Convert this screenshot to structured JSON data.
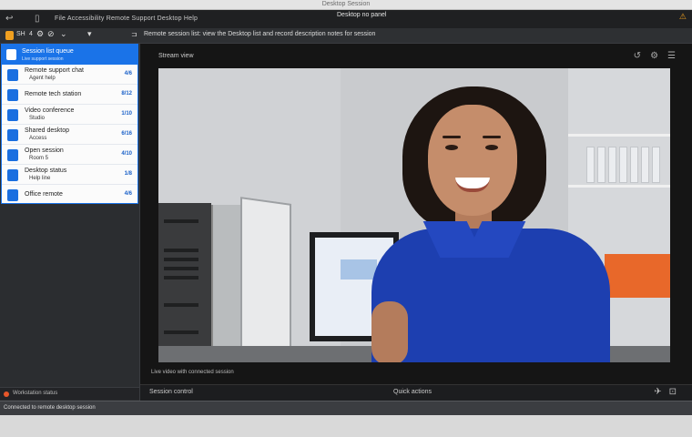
{
  "window": {
    "os_title": "Desktop Session",
    "app_title": "Desktop no panel",
    "menu": "File Accessibility Remote Support Desktop Help",
    "warning_icon": "warning-icon"
  },
  "toolbar": {
    "session_label": "SH",
    "session_count": "4",
    "path": "Remote session list: view  the Desktop list and record description notes for session",
    "accent": "#f0a020"
  },
  "queue": {
    "header_title": "Session list queue",
    "header_sub": "Live support session",
    "items": [
      {
        "name": "Remote support chat",
        "sub": "Agent help",
        "value": "4/6"
      },
      {
        "name": "Remote tech station",
        "sub": "",
        "value": "8/12"
      },
      {
        "name": "Video conference",
        "sub": "Studio",
        "value": "1/10"
      },
      {
        "name": "Shared desktop",
        "sub": "Access",
        "value": "6/16"
      },
      {
        "name": "Open session",
        "sub": "Room 5",
        "value": "4/10"
      },
      {
        "name": "Desktop status",
        "sub": "Help line",
        "value": "1/8"
      },
      {
        "name": "Office remote",
        "sub": "",
        "value": "4/6"
      }
    ],
    "accent": "#1a73e8"
  },
  "sidebar_footer": "Workstation status",
  "main": {
    "stage_title": "Stream view",
    "caption": "Live video with connected session",
    "controls_left": "Session control",
    "controls_mid": "Quick actions"
  },
  "statusbar": "Connected to remote desktop session"
}
